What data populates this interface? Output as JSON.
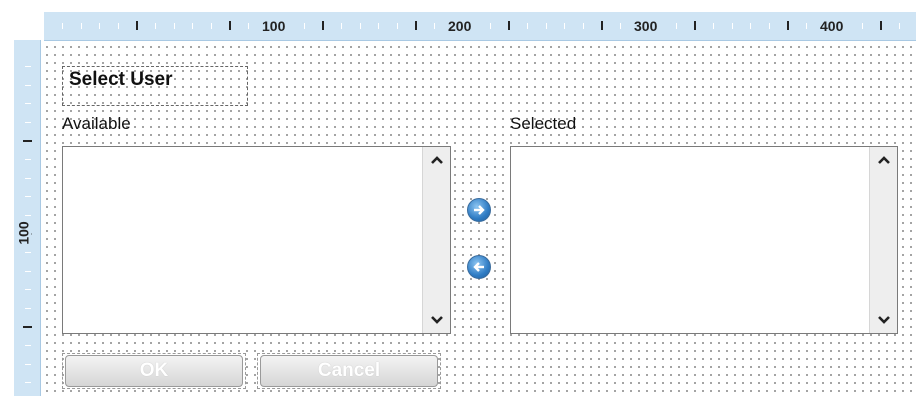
{
  "rulers": {
    "horizontal_labels": [
      "100",
      "200",
      "300",
      "400"
    ],
    "vertical_labels": [
      "100"
    ]
  },
  "dialog": {
    "title": "Select User",
    "available_label": "Available",
    "selected_label": "Selected",
    "available_items": [],
    "selected_items": [],
    "move_right_icon": "arrow-right-circle-icon",
    "move_left_icon": "arrow-left-circle-icon",
    "ok_label": "OK",
    "cancel_label": "Cancel"
  },
  "colors": {
    "ruler_bg": "#cfe4f4",
    "accent_blue": "#2f7cc4"
  }
}
